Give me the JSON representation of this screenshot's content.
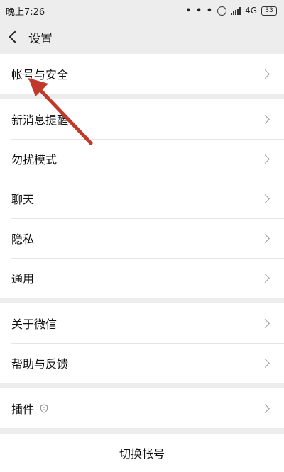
{
  "status_bar": {
    "time": "晚上7:26",
    "dots": "• • •",
    "network": "4G",
    "battery": "33"
  },
  "header": {
    "title": "设置"
  },
  "groups": [
    {
      "items": [
        "帐号与安全"
      ]
    },
    {
      "items": [
        "新消息提醒",
        "勿扰模式",
        "聊天",
        "隐私",
        "通用"
      ]
    },
    {
      "items": [
        "关于微信",
        "帮助与反馈"
      ]
    },
    {
      "items": [
        "插件"
      ]
    }
  ],
  "bottom": {
    "switch_account": "切换帐号"
  },
  "colors": {
    "background": "#ededed",
    "annotation_arrow": "#c0392b"
  }
}
